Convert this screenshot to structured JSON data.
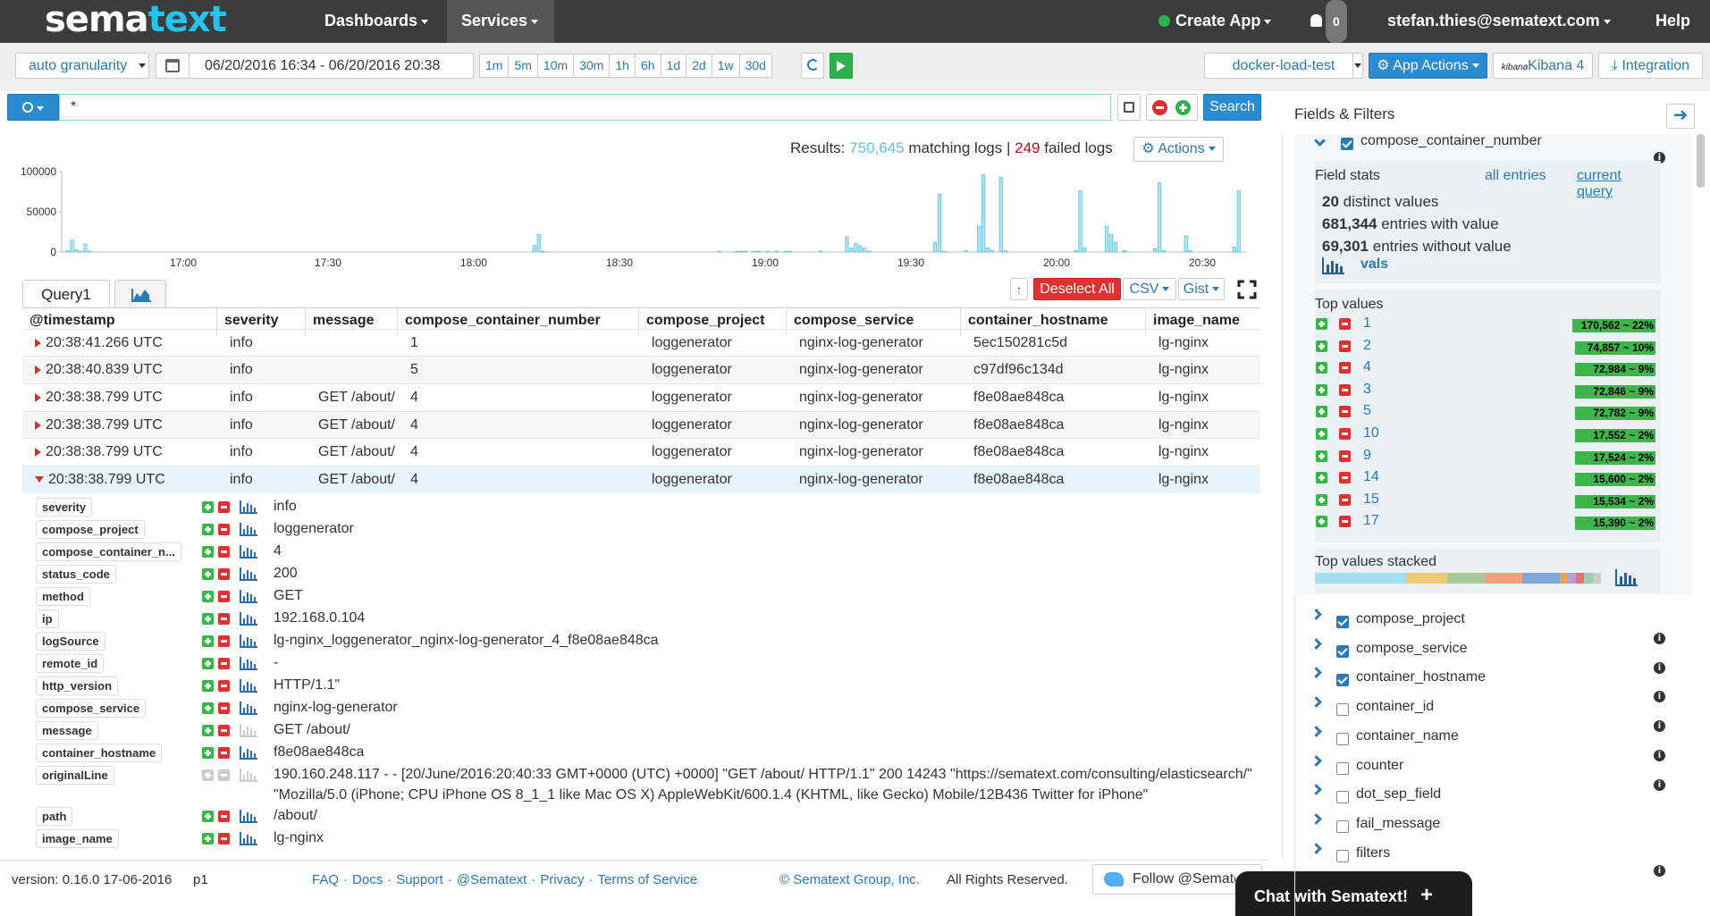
{
  "nav": {
    "logo_a": "sema",
    "logo_b": "text",
    "dashboards": "Dashboards",
    "services": "Services",
    "create_app": "Create App",
    "notifications": "0",
    "user": "stefan.thies@sematext.com",
    "help": "Help"
  },
  "toolbar": {
    "granularity": "auto granularity",
    "date_range": "06/20/2016 16:34 - 06/20/2016 20:38",
    "ranges": [
      "1m",
      "5m",
      "10m",
      "30m",
      "1h",
      "6h",
      "1d",
      "2d",
      "1w",
      "30d"
    ],
    "app": "docker-load-test",
    "app_actions": "App Actions",
    "kibana": "Kibana 4",
    "kibana_logo": "kibana",
    "integration": "Integration"
  },
  "search": {
    "query": "*",
    "button": "Search"
  },
  "results": {
    "label": "Results:",
    "matching_count": "750,645",
    "matching_label": "matching logs",
    "sep": "|",
    "failed_count": "249",
    "failed_label": "failed logs",
    "actions": "Actions"
  },
  "chart_data": {
    "type": "bar",
    "y_ticks": [
      "100000",
      "50000",
      "0"
    ],
    "ylim": [
      0,
      100000
    ],
    "x_ticks": [
      "17:00",
      "17:30",
      "18:00",
      "18:30",
      "19:00",
      "19:30",
      "20:00",
      "20:30"
    ],
    "values": [
      2000,
      15000,
      3000,
      1000,
      10000,
      1000,
      0,
      0,
      0,
      0,
      0,
      0,
      0,
      0,
      0,
      0,
      0,
      0,
      0,
      0,
      0,
      0,
      0,
      0,
      0,
      0,
      0,
      0,
      0,
      0,
      0,
      0,
      0,
      0,
      0,
      0,
      0,
      0,
      0,
      0,
      0,
      0,
      0,
      0,
      0,
      0,
      0,
      0,
      0,
      0,
      0,
      0,
      0,
      0,
      0,
      0,
      0,
      0,
      0,
      0,
      0,
      0,
      0,
      0,
      0,
      0,
      0,
      0,
      0,
      0,
      0,
      0,
      0,
      0,
      0,
      0,
      0,
      0,
      0,
      0,
      0,
      0,
      0,
      0,
      0,
      0,
      0,
      0,
      0,
      0,
      0,
      0,
      0,
      0,
      0,
      0,
      0,
      0,
      0,
      0,
      0,
      0,
      0,
      0,
      0,
      0,
      8000,
      22000,
      1000,
      0,
      0,
      0,
      0,
      0,
      0,
      0,
      0,
      0,
      0,
      0,
      0,
      0,
      0,
      0,
      0,
      0,
      0,
      0,
      0,
      0,
      0,
      0,
      0,
      0,
      0,
      0,
      0,
      0,
      0,
      0,
      0,
      0,
      0,
      0,
      0,
      0,
      0,
      0,
      1000,
      0,
      0,
      0,
      1000,
      1000,
      1000,
      0,
      1000,
      1000,
      0,
      1000,
      0,
      1000,
      0,
      1000,
      1000,
      0,
      0,
      0,
      0,
      0,
      0,
      1000,
      0,
      0,
      0,
      0,
      0,
      19000,
      5000,
      11000,
      8000,
      5000,
      1000,
      0,
      0,
      0,
      0,
      0,
      0,
      0,
      0,
      0,
      0,
      0,
      0,
      0,
      0,
      12000,
      72000,
      1000,
      0,
      0,
      0,
      0,
      2000,
      0,
      0,
      32000,
      96000,
      5000,
      2000,
      0,
      93000,
      2000,
      0,
      0,
      0,
      0,
      0,
      0,
      0,
      0,
      0,
      0,
      0,
      0,
      0,
      0,
      0,
      2000,
      76000,
      5000,
      0,
      0,
      0,
      0,
      32000,
      22000,
      12000,
      0,
      2000,
      0,
      0,
      0,
      0,
      0,
      0,
      4000,
      86000,
      2000,
      0,
      0,
      0,
      0,
      20000,
      2000,
      0,
      0,
      0,
      0,
      0,
      0,
      0,
      0,
      0,
      6000,
      76000
    ]
  },
  "tabs": {
    "query": "Query1"
  },
  "table_actions": {
    "deselect": "Deselect All",
    "csv": "CSV",
    "gist": "Gist"
  },
  "table": {
    "headers": [
      "@timestamp",
      "severity",
      "message",
      "compose_container_number",
      "compose_project",
      "compose_service",
      "container_hostname",
      "image_name"
    ],
    "rows": [
      [
        "20:38:41.266  UTC",
        "info",
        "",
        "1",
        "loggenerator",
        "nginx-log-generator",
        "5ec150281c5d",
        "lg-nginx"
      ],
      [
        "20:38:40.839  UTC",
        "info",
        "",
        "5",
        "loggenerator",
        "nginx-log-generator",
        "c97df96c134d",
        "lg-nginx"
      ],
      [
        "20:38:38.799  UTC",
        "info",
        "GET /about/",
        "4",
        "loggenerator",
        "nginx-log-generator",
        "f8e08ae848ca",
        "lg-nginx"
      ],
      [
        "20:38:38.799  UTC",
        "info",
        "GET /about/",
        "4",
        "loggenerator",
        "nginx-log-generator",
        "f8e08ae848ca",
        "lg-nginx"
      ],
      [
        "20:38:38.799  UTC",
        "info",
        "GET /about/",
        "4",
        "loggenerator",
        "nginx-log-generator",
        "f8e08ae848ca",
        "lg-nginx"
      ],
      [
        "20:38:38.799  UTC",
        "info",
        "GET /about/",
        "4",
        "loggenerator",
        "nginx-log-generator",
        "f8e08ae848ca",
        "lg-nginx"
      ]
    ]
  },
  "details": [
    {
      "k": "severity",
      "v": "info"
    },
    {
      "k": "compose_project",
      "v": "loggenerator"
    },
    {
      "k": "compose_container_n...",
      "v": "4"
    },
    {
      "k": "status_code",
      "v": "200"
    },
    {
      "k": "method",
      "v": "GET"
    },
    {
      "k": "ip",
      "v": "192.168.0.104"
    },
    {
      "k": "logSource",
      "v": "lg-nginx_loggenerator_nginx-log-generator_4_f8e08ae848ca"
    },
    {
      "k": "remote_id",
      "v": "-"
    },
    {
      "k": "http_version",
      "v": "HTTP/1.1\""
    },
    {
      "k": "compose_service",
      "v": "nginx-log-generator"
    },
    {
      "k": "message",
      "v": "GET /about/"
    },
    {
      "k": "container_hostname",
      "v": "f8e08ae848ca"
    },
    {
      "k": "originalLine",
      "v": "190.160.248.117 - - [20/June/2016:20:40:33 GMT+0000 (UTC) +0000] \"GET /about/ HTTP/1.1\" 200 14243 \"https://sematext.com/consulting/elasticsearch/\"",
      "v2": "\"Mozilla/5.0 (iPhone; CPU iPhone OS 8_1_1 like Mac OS X) AppleWebKit/600.1.4 (KHTML, like Gecko) Mobile/12B436 Twitter for iPhone\""
    },
    {
      "k": "path",
      "v": "/about/"
    },
    {
      "k": "image_name",
      "v": "lg-nginx"
    }
  ],
  "footer": {
    "version": "version: 0.16.0 17-06-2016",
    "page": "p1",
    "links": [
      "FAQ",
      "Docs",
      "Support",
      "@Sematext",
      "Privacy",
      "Terms of Service"
    ],
    "dot": "·",
    "copyright": "© Sematext Group, Inc.",
    "rights": "All Rights Reserved.",
    "follow": "Follow @Semate"
  },
  "chat": {
    "label": "Chat with Sematext!",
    "plus": "+"
  },
  "panel": {
    "title": "Fields & Filters",
    "field": "compose_container_number",
    "field_stats": "Field stats",
    "all_entries": "all entries",
    "current_query": "current query",
    "distinct_n": "20",
    "distinct_l": "distinct values",
    "with_n": "681,344",
    "with_l": "entries with value",
    "without_n": "69,301",
    "without_l": "entries without value",
    "vals": "vals",
    "top_values": "Top values",
    "top": [
      {
        "v": "1",
        "c": "170,562 ~ 22%",
        "p": 22
      },
      {
        "v": "2",
        "c": "74,857 ~ 10%",
        "p": 10
      },
      {
        "v": "4",
        "c": "72,984 ~ 9%",
        "p": 9
      },
      {
        "v": "3",
        "c": "72,846 ~ 9%",
        "p": 9
      },
      {
        "v": "5",
        "c": "72,782 ~ 9%",
        "p": 9
      },
      {
        "v": "10",
        "c": "17,552 ~ 2%",
        "p": 2
      },
      {
        "v": "9",
        "c": "17,524 ~ 2%",
        "p": 2
      },
      {
        "v": "14",
        "c": "15,600 ~ 2%",
        "p": 2
      },
      {
        "v": "15",
        "c": "15,534 ~ 2%",
        "p": 2
      },
      {
        "v": "17",
        "c": "15,390 ~ 2%",
        "p": 2
      }
    ],
    "stacked": "Top values stacked",
    "stacked_colors": [
      "#a3dff0",
      "#f1c96e",
      "#a8c99a",
      "#f3a07a",
      "#7ea6d8",
      "#e8a25a",
      "#b5a0d8",
      "#f07070",
      "#9ad0b0",
      "#cccccc"
    ],
    "fields": [
      {
        "name": "compose_project",
        "on": true,
        "info": true
      },
      {
        "name": "compose_service",
        "on": true,
        "info": true
      },
      {
        "name": "container_hostname",
        "on": true,
        "info": true
      },
      {
        "name": "container_id",
        "on": false,
        "info": true
      },
      {
        "name": "container_name",
        "on": false,
        "info": true
      },
      {
        "name": "counter",
        "on": false,
        "info": true
      },
      {
        "name": "dot_sep_field",
        "on": false,
        "info": false
      },
      {
        "name": "fail_message",
        "on": false,
        "info": false
      },
      {
        "name": "filters",
        "on": false,
        "info": false
      }
    ]
  }
}
